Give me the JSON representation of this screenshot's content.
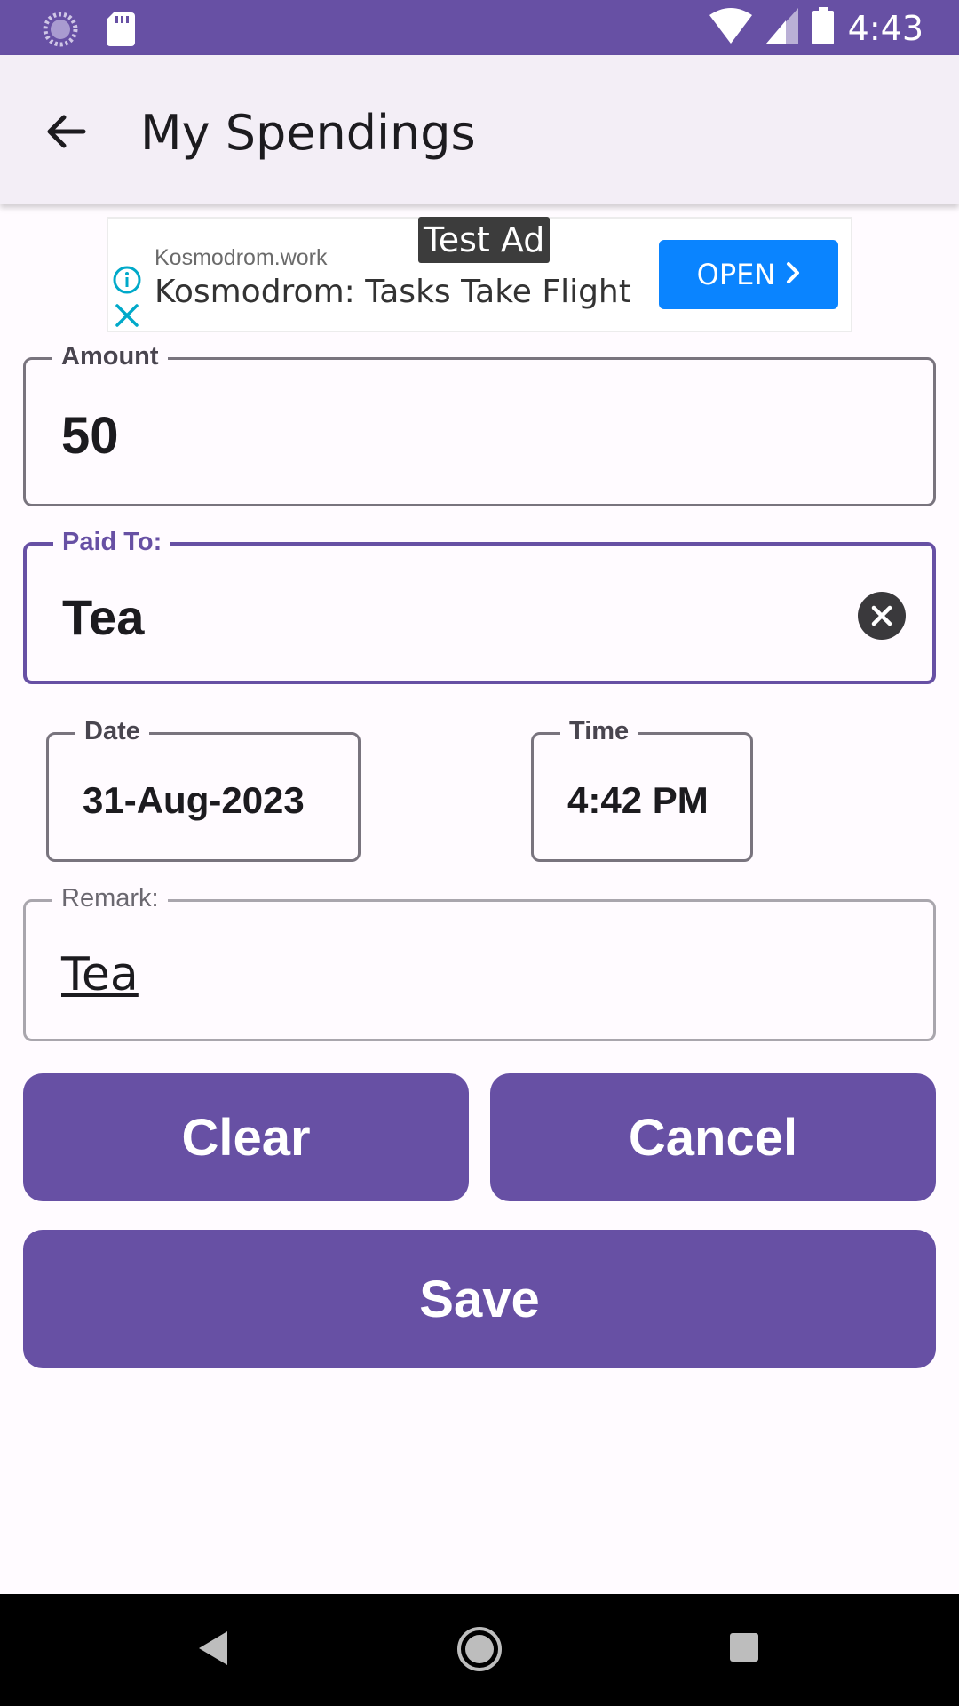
{
  "status_bar": {
    "time": "4:43",
    "icons": [
      "loading-icon",
      "sd-card-icon",
      "wifi-icon",
      "cell-signal-icon",
      "battery-icon"
    ]
  },
  "app_bar": {
    "title": "My Spendings",
    "back_icon": "arrow-left-icon"
  },
  "ad": {
    "badge": "Test Ad",
    "domain": "Kosmodrom.work",
    "headline": "Kosmodrom: Tasks Take Flight",
    "cta": "OPEN",
    "accent": "#0a84ff"
  },
  "form": {
    "amount": {
      "label": "Amount",
      "value": "50"
    },
    "paid_to": {
      "label": "Paid To:",
      "value": "Tea"
    },
    "date": {
      "label": "Date",
      "value": "31-Aug-2023"
    },
    "time": {
      "label": "Time",
      "value": "4:42 PM"
    },
    "remark": {
      "label": "Remark:",
      "value": "Tea"
    }
  },
  "buttons": {
    "clear": "Clear",
    "cancel": "Cancel",
    "save": "Save"
  },
  "colors": {
    "primary": "#6750a4",
    "background": "#fffbff"
  }
}
